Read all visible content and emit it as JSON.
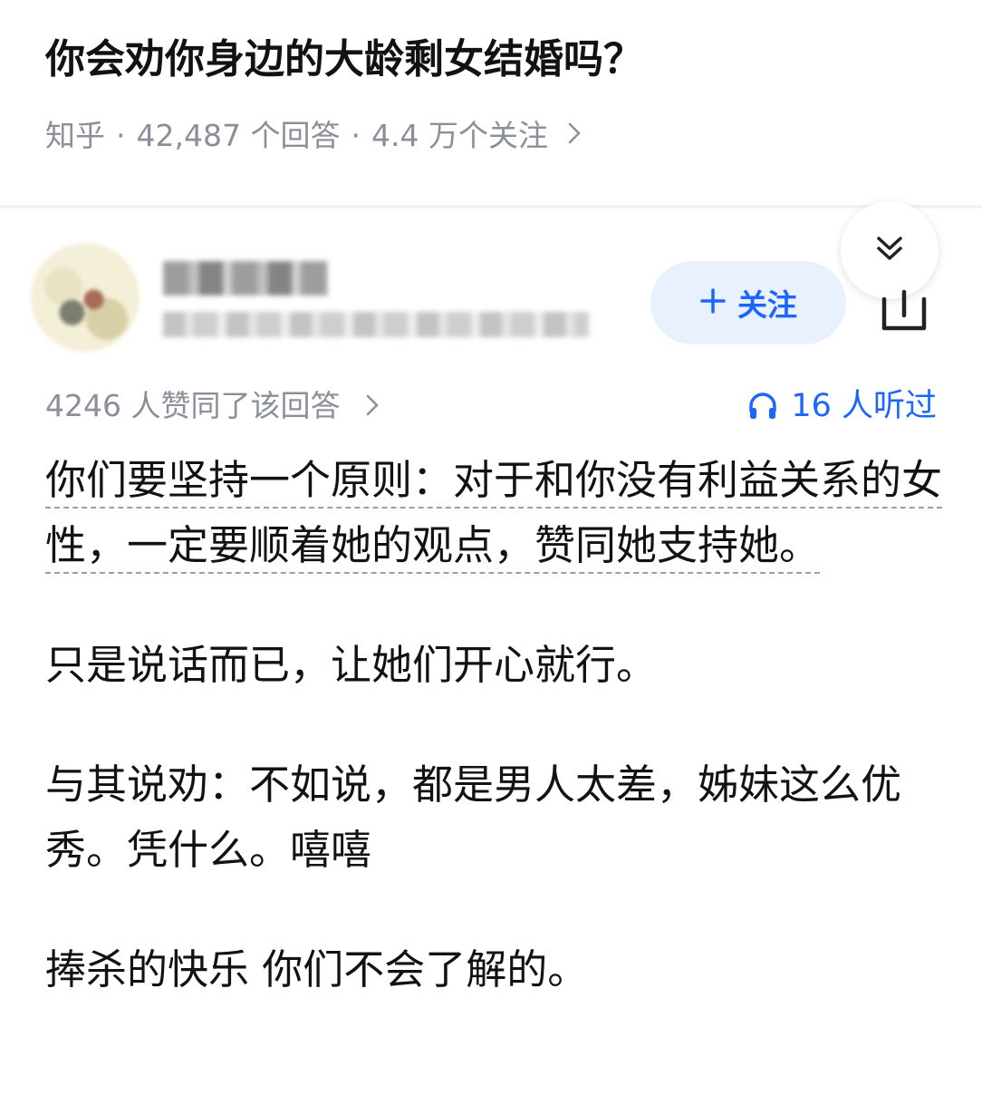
{
  "question": {
    "title": "你会劝你身边的大龄剩女结婚吗？",
    "source": "知乎",
    "answers": "42,487 个回答",
    "followers": "4.4 万个关注",
    "separator": "·"
  },
  "author": {
    "follow_label": "关注"
  },
  "answer": {
    "upvotes": "4246 人赞同了该回答",
    "listened": "16 人听过",
    "para1_underlined": "你们要坚持一个原则：对于和你没有利益关系的女性，一定要顺着她的观点，赞同她支持她。",
    "para2": "只是说话而已，让她们开心就行。",
    "para3": "与其说劝：不如说，都是男人太差，姊妹这么优秀。凭什么。嘻嘻",
    "para4": "捧杀的快乐 你们不会了解的。"
  },
  "colors": {
    "accent": "#1a66ff",
    "meta_gray": "#8a8f99",
    "follow_bg": "#e9f1fe"
  },
  "icons": [
    "chevron-right-icon",
    "double-chevron-down-icon",
    "share-icon",
    "headphones-icon",
    "plus-icon"
  ]
}
